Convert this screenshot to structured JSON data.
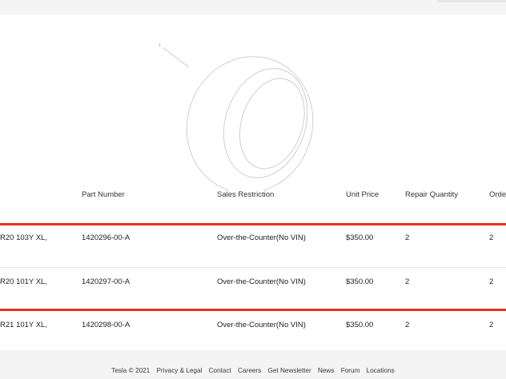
{
  "diagram": {
    "callout": "1"
  },
  "table": {
    "headers": {
      "part_number": "Part Number",
      "sales_restriction": "Sales Restriction",
      "unit_price": "Unit Price",
      "repair_quantity": "Repair Quantity",
      "order": "Orde"
    },
    "rows": [
      {
        "description": "R20 103Y XL,",
        "part_number": "1420296-00-A",
        "sales_restriction": "Over-the-Counter(No VIN)",
        "unit_price": "$350.00",
        "repair_quantity": "2",
        "order": "2"
      },
      {
        "description": "R20 101Y XL,",
        "part_number": "1420297-00-A",
        "sales_restriction": "Over-the-Counter(No VIN)",
        "unit_price": "$350.00",
        "repair_quantity": "2",
        "order": "2"
      },
      {
        "description": "R21 101Y XL,",
        "part_number": "1420298-00-A",
        "sales_restriction": "Over-the-Counter(No VIN)",
        "unit_price": "$350.00",
        "repair_quantity": "2",
        "order": "2"
      }
    ]
  },
  "footer": {
    "copyright": "Tesla © 2021",
    "links": [
      "Privacy & Legal",
      "Contact",
      "Careers",
      "Get Newsletter",
      "News",
      "Forum",
      "Locations"
    ]
  },
  "colors": {
    "highlight": "#e8311b",
    "background": "#f4f4f4",
    "panel": "#ffffff"
  }
}
